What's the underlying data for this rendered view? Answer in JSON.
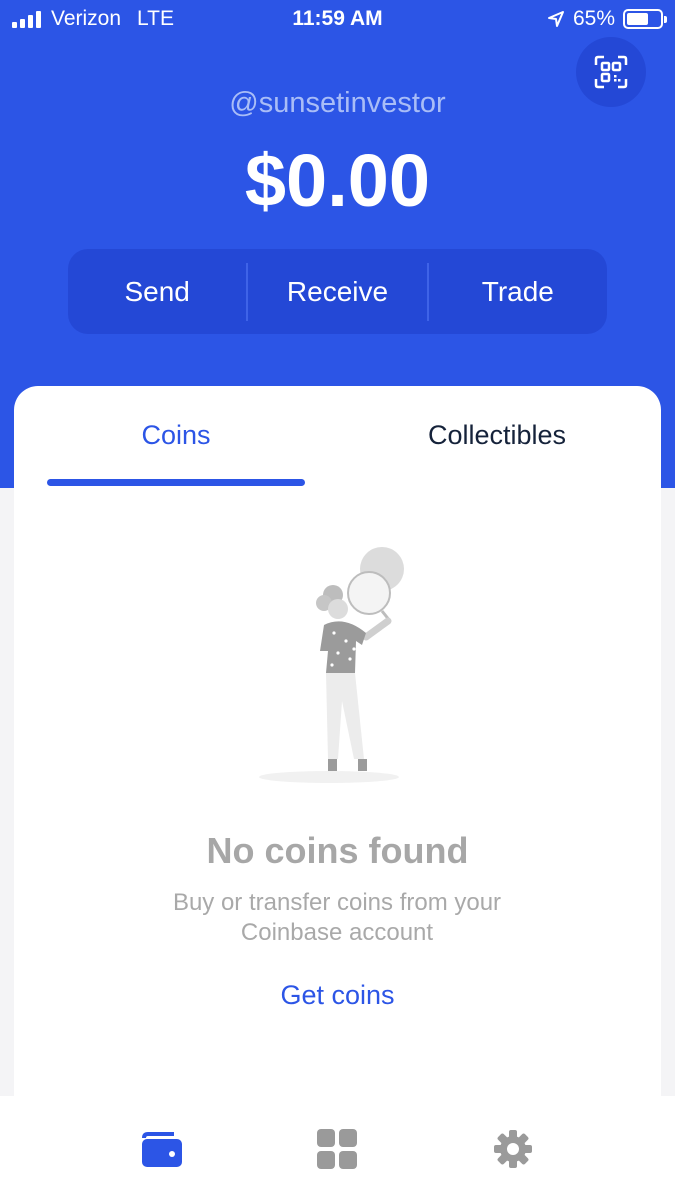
{
  "status_bar": {
    "carrier": "Verizon",
    "network": "LTE",
    "time": "11:59 AM",
    "battery": "65%",
    "battery_level": 0.65
  },
  "header": {
    "username": "@sunsetinvestor",
    "balance": "$0.00",
    "qr_icon": "qr-scan-icon"
  },
  "actions": {
    "send": "Send",
    "receive": "Receive",
    "trade": "Trade"
  },
  "tabs": {
    "coins": "Coins",
    "collectibles": "Collectibles",
    "active": "coins"
  },
  "empty_state": {
    "title": "No coins found",
    "subtitle": "Buy or transfer coins from your Coinbase account",
    "cta": "Get coins"
  },
  "bottom_nav": {
    "items": [
      "wallet-icon",
      "apps-grid-icon",
      "settings-gear-icon"
    ],
    "active": "wallet-icon"
  },
  "colors": {
    "brand": "#2c55e6",
    "header_dark": "#2448d6",
    "muted_text": "#a7a7a7",
    "inactive_icon": "#9a9a9a"
  }
}
